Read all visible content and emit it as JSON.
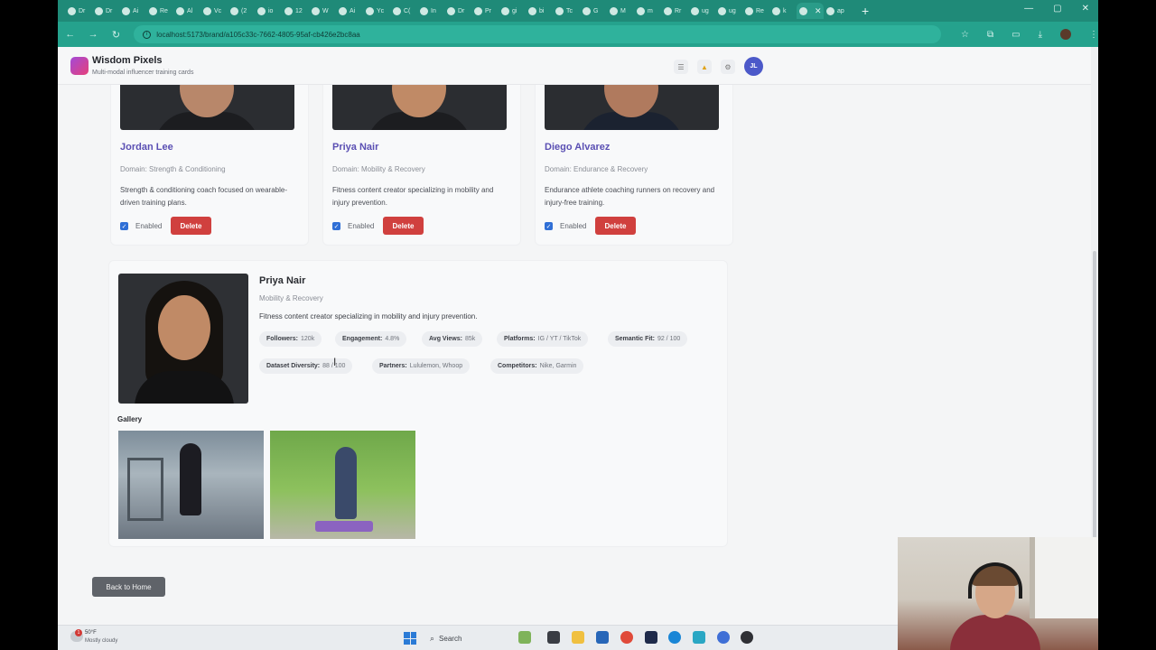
{
  "browser": {
    "url": "localhost:5173/brand/a105c33c-7662-4805-95af-cb426e2bc8aa",
    "tabs": [
      "Dr",
      "Dr",
      "Ai",
      "Re",
      "Al",
      "Vc",
      "(2",
      "io",
      "12",
      "W",
      "Ai",
      "Yc",
      "C(",
      "In",
      "Dr",
      "Pr",
      "gi",
      "bi",
      "Tc",
      "G",
      "M",
      "m",
      "Rr",
      "ug",
      "ug",
      "Re",
      "k",
      "",
      "ap"
    ]
  },
  "app": {
    "title": "Wisdom Pixels",
    "subtitle": "Multi-modal influencer training cards",
    "user_initials": "JL"
  },
  "cards": [
    {
      "name": "Jordan Lee",
      "domain": "Domain: Strength & Conditioning",
      "bio": "Strength & conditioning coach focused on wearable-driven training plans.",
      "enabled_label": "Enabled",
      "delete_label": "Delete"
    },
    {
      "name": "Priya Nair",
      "domain": "Domain: Mobility & Recovery",
      "bio": "Fitness content creator specializing in mobility and injury prevention.",
      "enabled_label": "Enabled",
      "delete_label": "Delete"
    },
    {
      "name": "Diego Alvarez",
      "domain": "Domain: Endurance & Recovery",
      "bio": "Endurance athlete coaching runners on recovery and injury-free training.",
      "enabled_label": "Enabled",
      "delete_label": "Delete"
    }
  ],
  "detail": {
    "name": "Priya Nair",
    "domain": "Mobility & Recovery",
    "bio": "Fitness content creator specializing in mobility and injury prevention.",
    "stats": [
      {
        "label": "Followers:",
        "value": "120k"
      },
      {
        "label": "Engagement:",
        "value": "4.8%"
      },
      {
        "label": "Avg Views:",
        "value": "85k"
      },
      {
        "label": "Platforms:",
        "value": "IG / YT / TikTok"
      },
      {
        "label": "Semantic Fit:",
        "value": "92 / 100"
      },
      {
        "label": "Dataset Diversity:",
        "value": "88 / 100"
      },
      {
        "label": "Partners:",
        "value": "Lululemon, Whoop"
      },
      {
        "label": "Competitors:",
        "value": "Nike, Garmin"
      }
    ],
    "gallery_label": "Gallery"
  },
  "back_label": "Back to Home",
  "taskbar": {
    "weather_temp": "50°F",
    "weather_cond": "Mostly cloudy",
    "weather_badge": "1",
    "search_label": "Search"
  }
}
